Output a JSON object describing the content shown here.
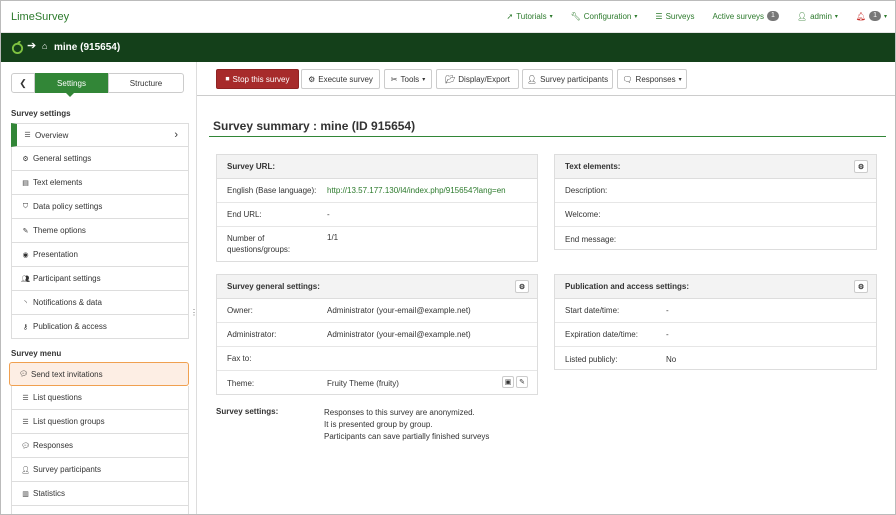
{
  "app": {
    "brand": "LimeSurvey",
    "title_bar": "mine (915654)"
  },
  "topnav": {
    "tutorials": "Tutorials",
    "configuration": "Configuration",
    "surveys": "Surveys",
    "active_surveys": "Active surveys",
    "active_count": "1",
    "user": "admin",
    "notif_count": "1"
  },
  "sidebar": {
    "tab_settings": "Settings",
    "tab_structure": "Structure",
    "survey_settings_head": "Survey settings",
    "settings_items": [
      {
        "label": "Overview",
        "icon": "list-icon"
      },
      {
        "label": "General settings",
        "icon": "gears-icon"
      },
      {
        "label": "Text elements",
        "icon": "file-text-icon"
      },
      {
        "label": "Data policy settings",
        "icon": "shield-icon"
      },
      {
        "label": "Theme options",
        "icon": "paint-brush-icon"
      },
      {
        "label": "Presentation",
        "icon": "eye-icon"
      },
      {
        "label": "Participant settings",
        "icon": "users-icon"
      },
      {
        "label": "Notifications & data",
        "icon": "feed-icon"
      },
      {
        "label": "Publication & access",
        "icon": "key-icon"
      }
    ],
    "survey_menu_head": "Survey menu",
    "menu_items": [
      {
        "label": "Send text invitations",
        "icon": "comment-icon"
      },
      {
        "label": "List questions",
        "icon": "list-icon"
      },
      {
        "label": "List question groups",
        "icon": "list-icon"
      },
      {
        "label": "Responses",
        "icon": "comment-icon"
      },
      {
        "label": "Survey participants",
        "icon": "user-icon"
      },
      {
        "label": "Statistics",
        "icon": "bar-chart-icon"
      }
    ]
  },
  "toolbar": {
    "stop": "Stop this survey",
    "execute": "Execute survey",
    "tools": "Tools",
    "display_export": "Display/Export",
    "participants": "Survey participants",
    "responses": "Responses"
  },
  "main": {
    "title": "Survey summary : mine (ID 915654)",
    "survey_url": {
      "head": "Survey URL:",
      "rows": [
        {
          "k": "English (Base language):",
          "v": "http://13.57.177.130/l4/index.php/915654?lang=en"
        },
        {
          "k": "End URL:",
          "v": "-"
        },
        {
          "k": "Number of questions/groups:",
          "v": "1/1"
        }
      ]
    },
    "text_elements": {
      "head": "Text elements:",
      "rows": [
        {
          "k": "Description:"
        },
        {
          "k": "Welcome:"
        },
        {
          "k": "End message:"
        }
      ]
    },
    "general_settings": {
      "head": "Survey general settings:",
      "rows": [
        {
          "k": "Owner:",
          "v": "Administrator (your-email@example.net)"
        },
        {
          "k": "Administrator:",
          "v": "Administrator (your-email@example.net)"
        },
        {
          "k": "Fax to:",
          "v": ""
        },
        {
          "k": "Theme:",
          "v": "Fruity Theme (fruity)"
        }
      ]
    },
    "publication": {
      "head": "Publication and access settings:",
      "rows": [
        {
          "k": "Start date/time:",
          "v": "-"
        },
        {
          "k": "Expiration date/time:",
          "v": "-"
        },
        {
          "k": "Listed publicly:",
          "v": "No"
        }
      ]
    },
    "survey_settings": {
      "label": "Survey settings:",
      "lines": [
        "Responses to this survey are anonymized.",
        "It is presented group by group.",
        "Participants can save partially finished surveys"
      ]
    }
  },
  "colors": {
    "brand_green": "#328637",
    "dark_green": "#14401a",
    "danger": "#a72b2b"
  }
}
